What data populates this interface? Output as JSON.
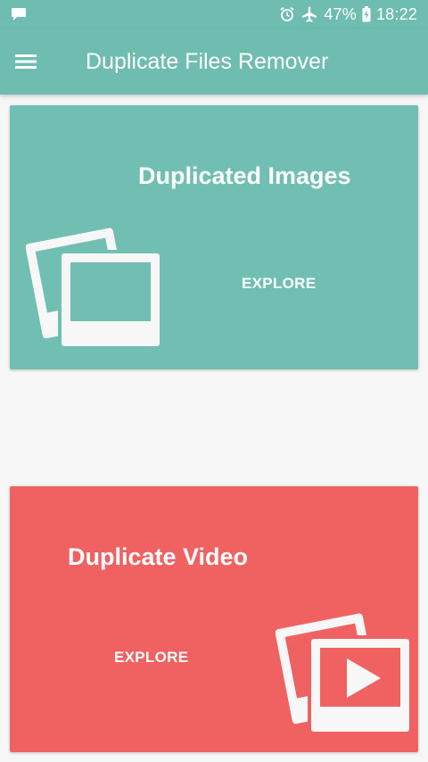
{
  "status_bar": {
    "battery_percent": "47%",
    "time": "18:22",
    "icons": [
      "chat-notification-icon",
      "alarm-icon",
      "airplane-mode-icon",
      "battery-charging-icon"
    ]
  },
  "app_bar": {
    "title": "Duplicate Files Remover",
    "menu_icon": "menu-icon"
  },
  "cards": [
    {
      "title": "Duplicated Images",
      "action_label": "EXPLORE",
      "icon": "photos-icon",
      "color": "#70bfb2"
    },
    {
      "title": "Duplicate Video",
      "action_label": "EXPLORE",
      "icon": "video-photos-icon",
      "color": "#f06161"
    }
  ],
  "colors": {
    "primary": "#6fbdb0",
    "accent_red": "#f06161",
    "background": "#f6f6f6",
    "text_on_primary": "#ffffff"
  }
}
